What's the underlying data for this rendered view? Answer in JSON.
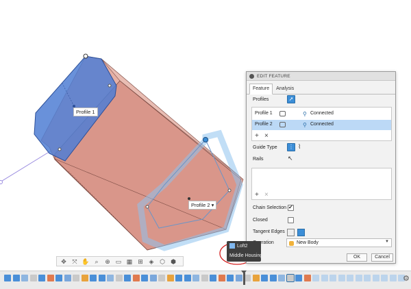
{
  "panel": {
    "header_title": "EDIT FEATURE",
    "tabs": [
      "Feature",
      "Analysis"
    ],
    "profiles_label": "Profiles",
    "profiles": [
      {
        "name": "Profile 1",
        "status": "Connected"
      },
      {
        "name": "Profile 2",
        "status": "Connected"
      }
    ],
    "add_symbol": "+",
    "remove_symbol": "×",
    "guide_type_label": "Guide Type",
    "rails_label": "Rails",
    "chain_selection_label": "Chain Selection",
    "closed_label": "Closed",
    "tangent_edges_label": "Tangent Edges",
    "operation_label": "Operation",
    "operation_value": "New Body",
    "ok_label": "OK",
    "cancel_label": "Cancel"
  },
  "viewport": {
    "profile1_label": "Profile 1",
    "profile2_label": "Profile 2",
    "profile2_arrow": "▾"
  },
  "tooltip": {
    "title": "Loft2",
    "subtitle": "Middle Housing"
  },
  "colors": {
    "selection_blue": "#3c8ed7",
    "body_salmon": "#d9968a",
    "profile_blue": "#4f7ed3",
    "annotation_red": "#d42020"
  },
  "icons": {
    "navbar": [
      "orbit-icon",
      "pan-icon",
      "hand-icon",
      "zoom-icon",
      "zoom-window-icon",
      "display-icon",
      "grid-icon",
      "viewports-icon",
      "cube-icon",
      "cube-outline-icon",
      "cube-alt-icon"
    ]
  }
}
